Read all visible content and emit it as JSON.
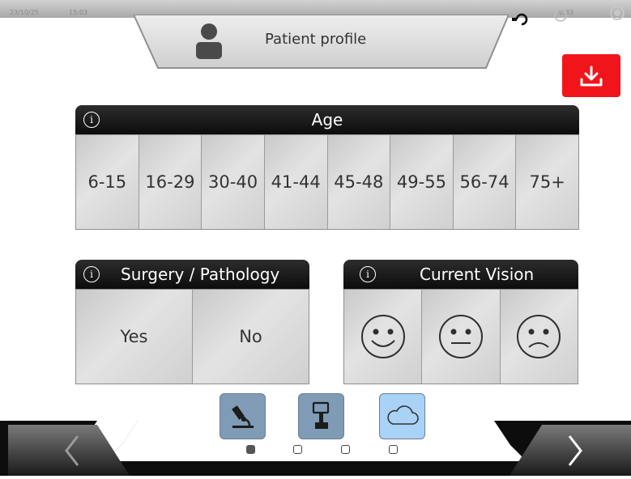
{
  "status": {
    "date": "23/10/25",
    "time": "15:03",
    "timer": "0:33"
  },
  "header": {
    "title": "Patient profile"
  },
  "age": {
    "title": "Age",
    "options": [
      "6-15",
      "16-29",
      "30-40",
      "41-44",
      "45-48",
      "49-55",
      "56-74",
      "75+"
    ]
  },
  "surgery": {
    "title": "Surgery / Pathology",
    "options": [
      "Yes",
      "No"
    ]
  },
  "vision": {
    "title": "Current Vision",
    "options": [
      "happy-face-icon",
      "neutral-face-icon",
      "sad-face-icon"
    ]
  },
  "modes": [
    "microscope-icon",
    "device-icon",
    "cloud-icon"
  ],
  "pager": {
    "pages": 4,
    "current": 1
  },
  "colors": {
    "accent_red": "#f1151b",
    "selected_mode": "#a9d2f7",
    "mode_blue": "#7f9bb5"
  }
}
